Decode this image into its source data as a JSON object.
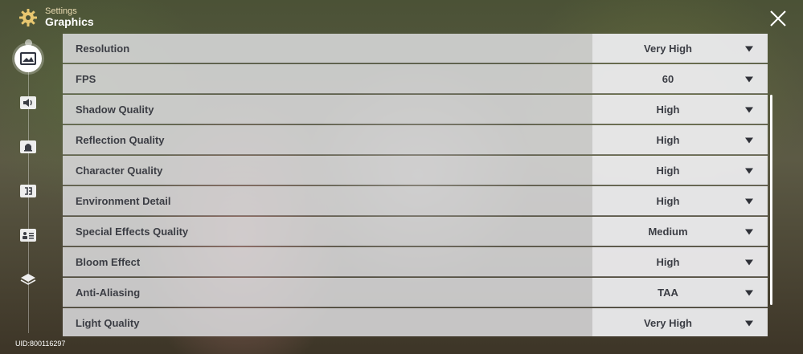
{
  "header": {
    "subtitle": "Settings",
    "title": "Graphics"
  },
  "sidebar": {
    "items": [
      {
        "name": "graphics",
        "icon": "image-icon",
        "active": true
      },
      {
        "name": "audio",
        "icon": "speaker-icon",
        "active": false
      },
      {
        "name": "notifications",
        "icon": "bell-icon",
        "active": false
      },
      {
        "name": "language",
        "icon": "language-icon",
        "active": false
      },
      {
        "name": "account",
        "icon": "id-card-icon",
        "active": false
      },
      {
        "name": "other",
        "icon": "layers-icon",
        "active": false
      }
    ]
  },
  "settings": [
    {
      "label": "Resolution",
      "value": "Very High"
    },
    {
      "label": "FPS",
      "value": "60"
    },
    {
      "label": "Shadow Quality",
      "value": "High"
    },
    {
      "label": "Reflection Quality",
      "value": "High"
    },
    {
      "label": "Character Quality",
      "value": "High"
    },
    {
      "label": "Environment Detail",
      "value": "High"
    },
    {
      "label": "Special Effects Quality",
      "value": "Medium"
    },
    {
      "label": "Bloom Effect",
      "value": "High"
    },
    {
      "label": "Anti-Aliasing",
      "value": "TAA"
    },
    {
      "label": "Light Quality",
      "value": "Very High"
    }
  ],
  "footer": {
    "uid": "UID:800116297"
  },
  "colors": {
    "accent_gold": "#e8c770",
    "text_dark": "#3b3d44"
  }
}
